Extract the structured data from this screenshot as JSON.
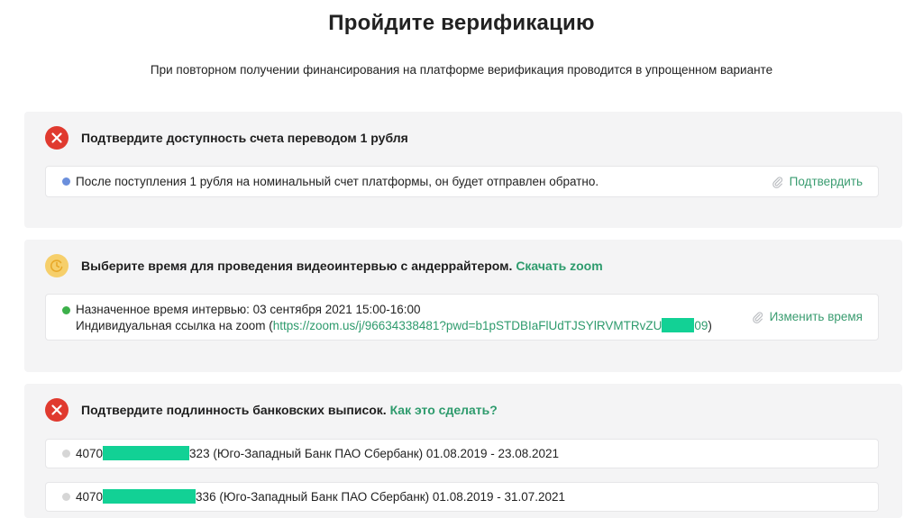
{
  "header": {
    "title": "Пройдите верификацию",
    "subtitle": "При повторном получении финансирования на платформе верификация проводится в упрощенном варианте"
  },
  "sections": [
    {
      "status": "error",
      "status_icon": "x-circle-icon",
      "title": "Подтвердите доступность счета переводом 1 рубля",
      "rows": [
        {
          "dot_color": "#6b8fdc",
          "text": "После поступления 1 рубля на номинальный счет платформы, он будет отправлен обратно.",
          "action_label": "Подтвердить",
          "action_icon": "paperclip-icon"
        }
      ]
    },
    {
      "status": "pending",
      "status_icon": "clock-icon",
      "title": "Выберите время для проведения видеоинтервью с андеррайтером.",
      "title_link": "Скачать zoom",
      "rows": [
        {
          "dot_color": "#3cb04a",
          "line1": "Назначенное время интервью: 03 сентября 2021 15:00-16:00",
          "line2_prefix": "Индивидуальная ссылка на zoom (",
          "line2_link_start": "https://zoom.us/j/96634338481?pwd=b1pSTDBIaFlUdTJSYlRVMTRvZU",
          "line2_link_end": "09",
          "line2_suffix": ")",
          "action_label": "Изменить время",
          "action_icon": "paperclip-icon"
        }
      ]
    },
    {
      "status": "error",
      "status_icon": "x-circle-icon",
      "title": "Подтвердите подлинность банковских выписок.",
      "title_link": "Как это сделать?",
      "rows": [
        {
          "dot_color": "#d6d6d6",
          "account_prefix": "4070",
          "account_suffix": "323 (Юго-Западный Банк ПАО Сбербанк) 01.08.2019 - 23.08.2021"
        },
        {
          "dot_color": "#d6d6d6",
          "account_prefix": "4070",
          "account_suffix": "336 (Юго-Западный Банк ПАО Сбербанк) 01.08.2019 - 31.07.2021"
        }
      ]
    }
  ],
  "colors": {
    "accent": "#2e9b6d",
    "error": "#e03a2f",
    "pending": "#f6cf6b",
    "redaction": "#12d195"
  }
}
